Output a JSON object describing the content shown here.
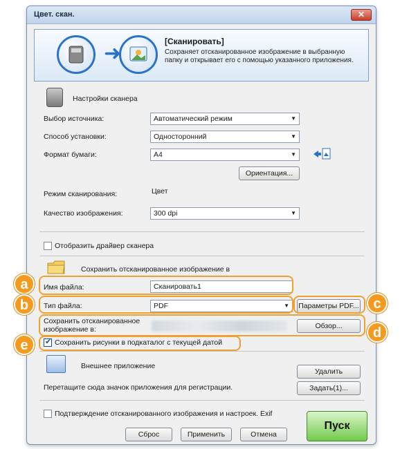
{
  "window": {
    "title": "Цвет. скан.",
    "close_label": "✕"
  },
  "banner": {
    "title": "[Сканировать]",
    "description": "Сохраняет отсканированное изображение в выбранную папку и открывает его с помощью указанного приложения."
  },
  "scanner_settings": {
    "section_title": "Настройки сканера",
    "source_label": "Выбор источника:",
    "source_value": "Автоматический режим",
    "method_label": "Способ установки:",
    "method_value": "Односторонний",
    "paper_label": "Формат бумаги:",
    "paper_value": "A4",
    "orientation_button": "Ориентация...",
    "scan_mode_label": "Режим сканирования:",
    "scan_mode_value": "Цвет",
    "quality_label": "Качество изображения:",
    "quality_value": "300 dpi",
    "show_driver_label": "Отобразить драйвер сканера",
    "show_driver_checked": false
  },
  "save_section": {
    "section_title": "Сохранить отсканированное изображение в",
    "filename_label": "Имя файла:",
    "filename_value": "Сканировать1",
    "filetype_label": "Тип файла:",
    "filetype_value": "PDF",
    "pdf_params_button": "Параметры PDF...",
    "save_path_label": "Сохранить отсканированное изображение в:",
    "browse_button": "Обзор...",
    "subfolder_label": "Сохранить рисунки в подкаталог с текущей датой",
    "subfolder_checked": true
  },
  "external_app": {
    "section_title": "Внешнее приложение",
    "delete_button": "Удалить",
    "drag_hint": "Перетащите сюда значок приложения для регистрации.",
    "set_button": "Задать(1)..."
  },
  "footer": {
    "confirm_label": "Подтверждение отсканированного изображения и настроек. Exif",
    "confirm_checked": false,
    "reset_button": "Сброс",
    "apply_button": "Применить",
    "cancel_button": "Отмена",
    "start_button": "Пуск"
  },
  "callouts": {
    "a": "a",
    "b": "b",
    "c": "c",
    "d": "d",
    "e": "e"
  },
  "colors": {
    "callout": "#f39a1f",
    "accent_blue": "#2a73c9",
    "start_green": "#74c94d"
  }
}
